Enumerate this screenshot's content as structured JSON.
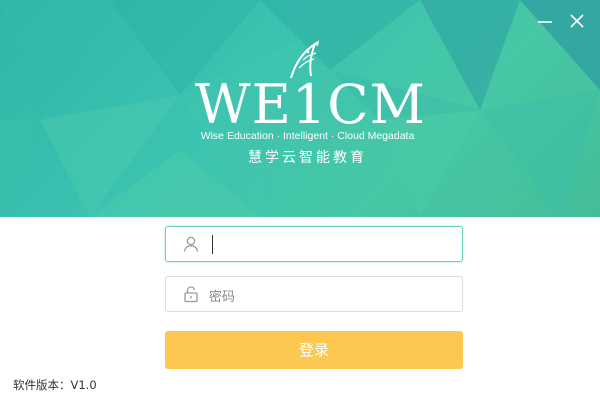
{
  "brand": {
    "logo_text": "WE1CM",
    "tagline_en": "Wise Education · Intelligent · Cloud Megadata",
    "tagline_cn": "慧学云智能教育"
  },
  "window_controls": {
    "minimize_icon": "minimize-icon",
    "close_icon": "close-icon"
  },
  "form": {
    "username": {
      "value": "",
      "placeholder": "",
      "icon": "user-icon"
    },
    "password": {
      "value": "",
      "placeholder": "密码",
      "icon": "lock-icon"
    },
    "login_label": "登录"
  },
  "footer": {
    "version_label": "软件版本：V1.0"
  },
  "colors": {
    "hero_teal": "#3cc3b0",
    "login_button": "#fcc851",
    "active_border": "#6fd0bf"
  }
}
